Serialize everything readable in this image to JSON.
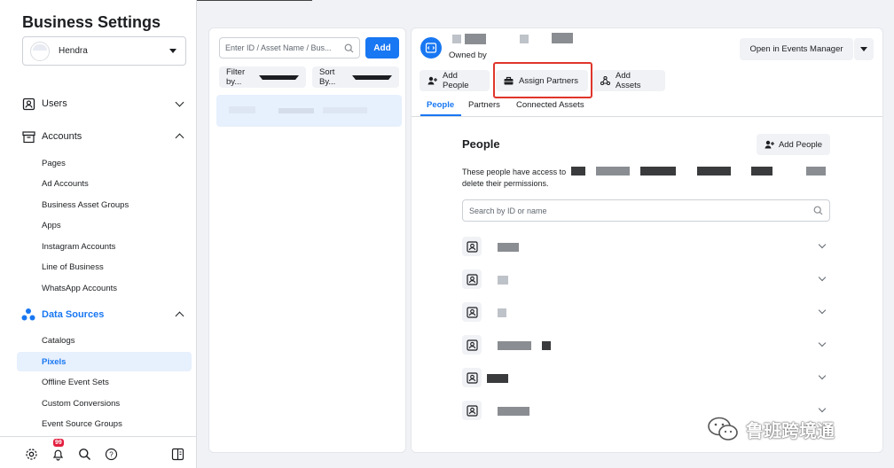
{
  "sidebar": {
    "title": "Business Settings",
    "account_name": "Hendra",
    "sections": {
      "users": "Users",
      "accounts": "Accounts",
      "data_sources": "Data Sources"
    },
    "accounts_items": [
      "Pages",
      "Ad Accounts",
      "Business Asset Groups",
      "Apps",
      "Instagram Accounts",
      "Line of Business",
      "WhatsApp Accounts"
    ],
    "data_source_items": [
      "Catalogs",
      "Pixels",
      "Offline Event Sets",
      "Custom Conversions",
      "Event Source Groups"
    ],
    "active_item": "Pixels",
    "notification_count": "99"
  },
  "list_panel": {
    "search_placeholder": "Enter ID / Asset Name / Bus...",
    "add_label": "Add",
    "filter_label": "Filter by...",
    "sort_label": "Sort By..."
  },
  "detail": {
    "owned_by": "Owned by",
    "open_events_manager": "Open in Events Manager",
    "actions": {
      "add_people": "Add People",
      "assign_partners": "Assign Partners",
      "add_assets": "Add Assets"
    },
    "tabs": [
      "People",
      "Partners",
      "Connected Assets"
    ],
    "active_tab": "People",
    "people": {
      "title": "People",
      "add_label": "Add People",
      "desc_line1": "These people have access to",
      "desc_line2": "delete their permissions.",
      "search_placeholder": "Search by ID or name"
    }
  },
  "watermark": "鲁班跨境通",
  "colors": {
    "accent": "#1877f2",
    "highlight": "#e0352b",
    "badge": "#e41e3f"
  }
}
